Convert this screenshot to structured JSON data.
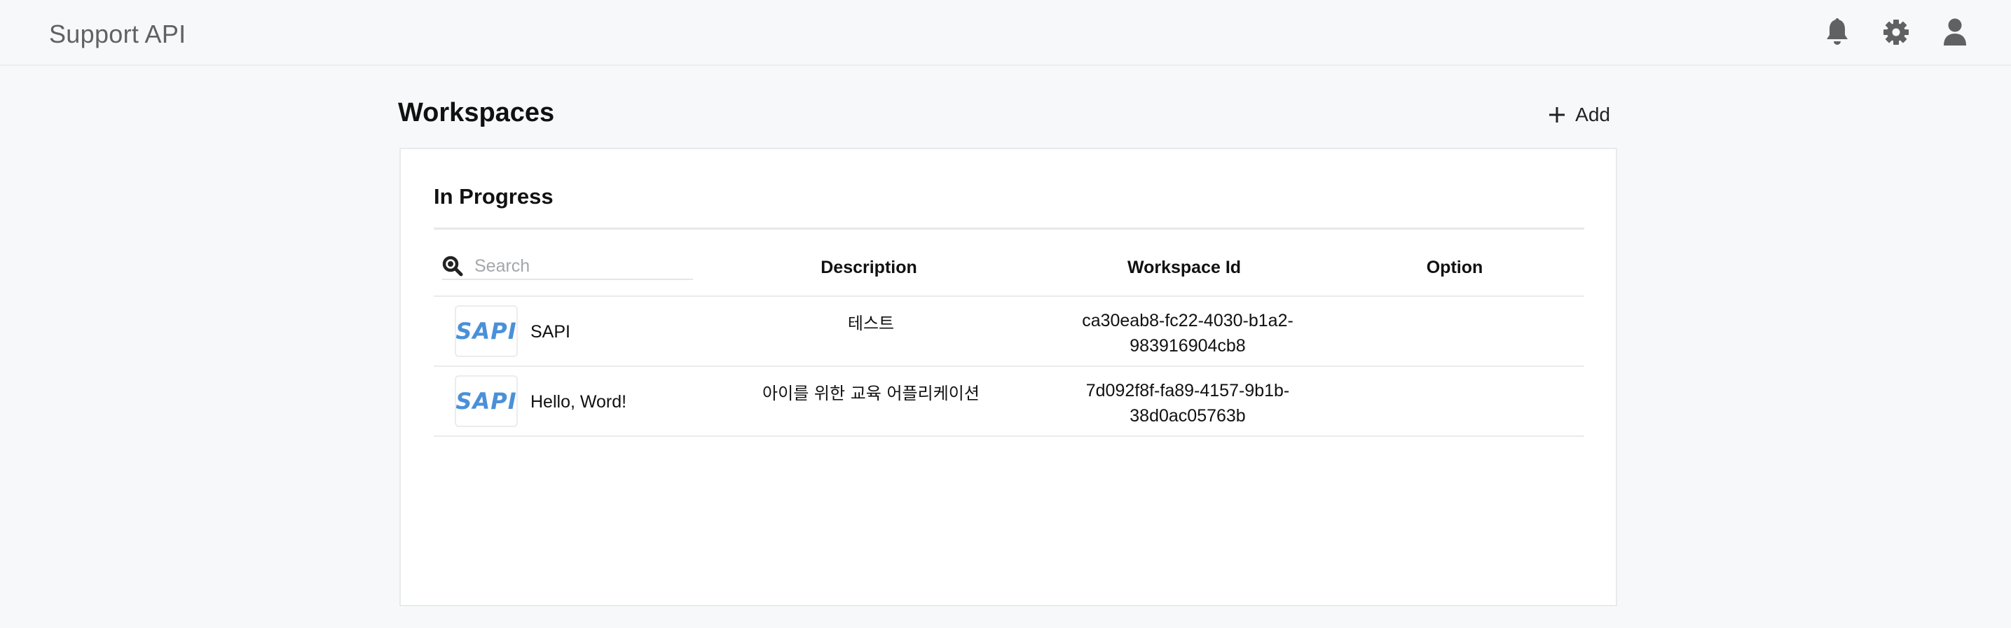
{
  "header": {
    "app_title": "Support API",
    "icons": [
      "bell-icon",
      "gear-icon",
      "user-icon"
    ]
  },
  "section": {
    "title": "Workspaces",
    "add_label": "Add"
  },
  "card": {
    "title": "In Progress",
    "search": {
      "placeholder": "Search",
      "value": ""
    },
    "columns": [
      "",
      "Description",
      "Workspace Id",
      "Option"
    ],
    "rows": [
      {
        "logo_text": "SAPI",
        "name": "SAPI",
        "description": "테스트",
        "workspace_id_line1": "ca30eab8-fc22-4030-b1a2-",
        "workspace_id_line2": "983916904cb8",
        "option": ""
      },
      {
        "logo_text": "SAPI",
        "name": "Hello, Word!",
        "description": "아이를 위한 교육 어플리케이션",
        "workspace_id_line1": "7d092f8f-fa89-4157-9b1b-",
        "workspace_id_line2": "38d0ac05763b",
        "option": ""
      }
    ]
  },
  "colors": {
    "background": "#f6f8f9",
    "logo_blue": "#4a90d9",
    "icon_gray": "#5f6163"
  }
}
